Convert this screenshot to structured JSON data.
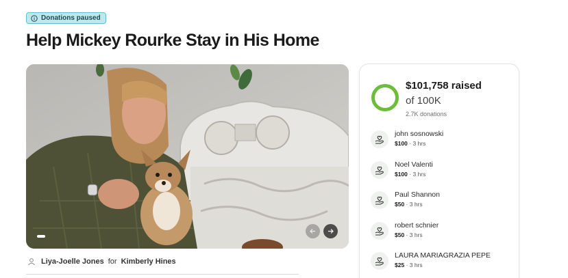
{
  "status_badge": {
    "label": "Donations paused",
    "icon": "info-icon"
  },
  "campaign": {
    "title": "Help Mickey Rourke Stay in His Home"
  },
  "hero": {
    "image_icon": "campaign-photo",
    "prev_icon": "arrow-left-icon",
    "next_icon": "arrow-right-icon"
  },
  "organizer": {
    "name": "Liya-Joelle Jones",
    "connector": "for",
    "beneficiary": "Kimberly Hines",
    "icon": "user-icon"
  },
  "summary": {
    "raised": "$101,758 raised",
    "goal": "of 100K",
    "donation_count": "2.7K donations",
    "progress_fraction": 1.0,
    "progress_color": "#6bbd3a"
  },
  "donations": [
    {
      "name": "john sosnowski",
      "amount": "$100",
      "time": " · 3 hrs"
    },
    {
      "name": "Noel Valenti",
      "amount": "$100",
      "time": " · 3 hrs"
    },
    {
      "name": "Paul Shannon",
      "amount": "$50",
      "time": " · 3 hrs"
    },
    {
      "name": "robert schnier",
      "amount": "$50",
      "time": " · 3 hrs"
    },
    {
      "name": "LAURA MARIAGRAZIA PEPE",
      "amount": "$25",
      "time": " · 3 hrs"
    }
  ],
  "colors": {
    "badge_bg": "#bfe8ee",
    "badge_border": "#5cbfcc",
    "progress": "#6bbd3a"
  }
}
